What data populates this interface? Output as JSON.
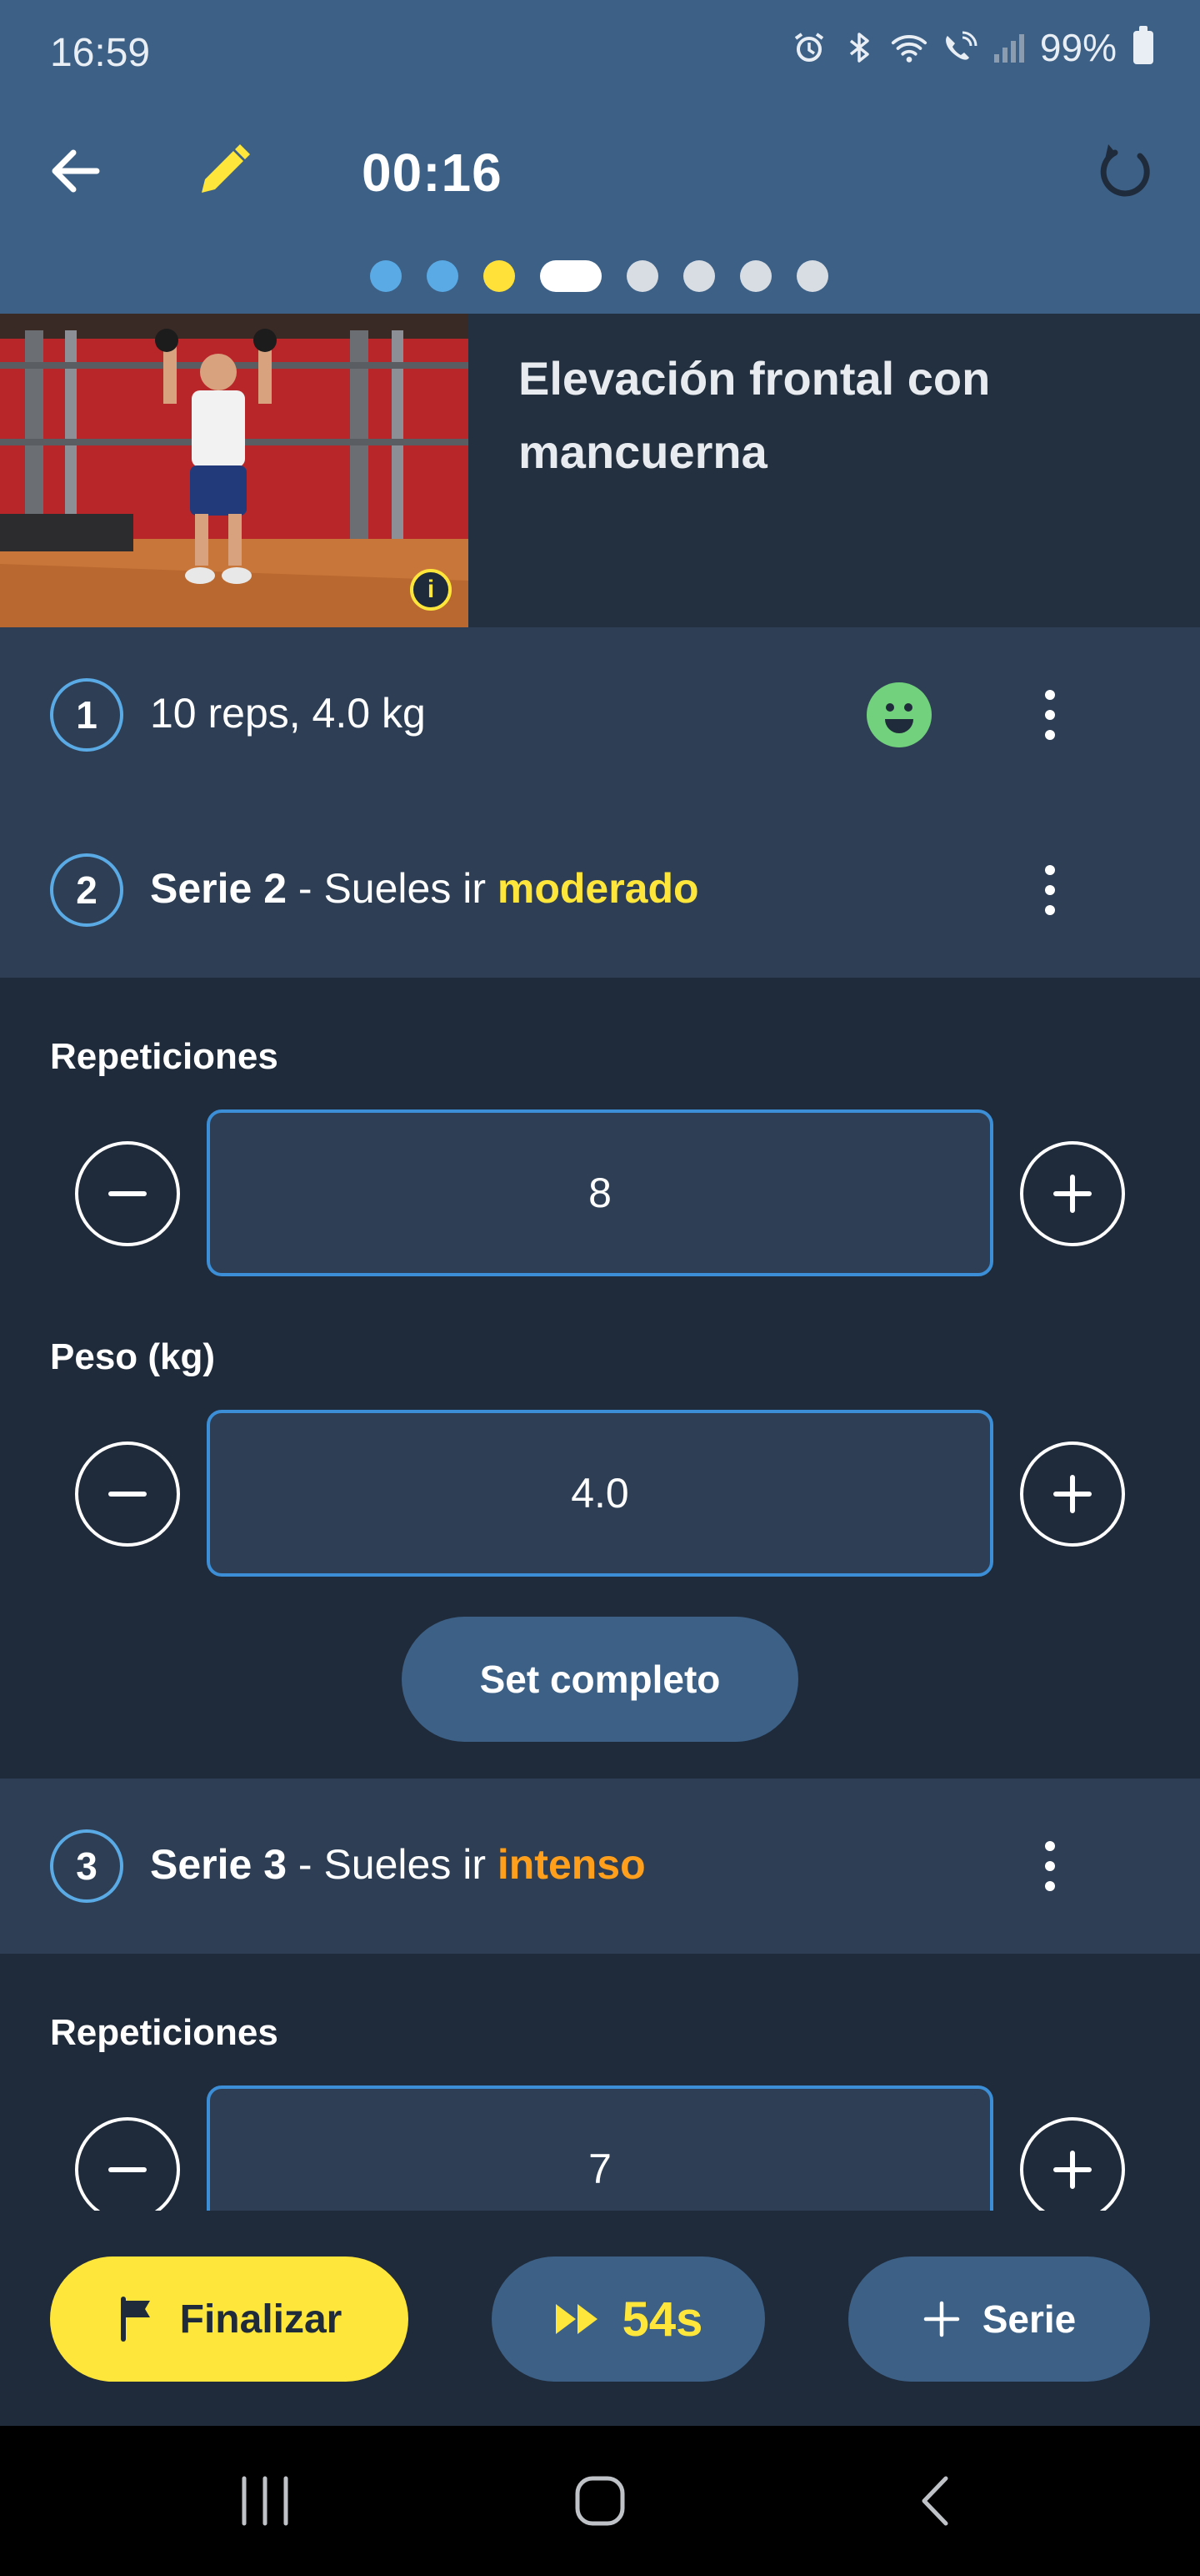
{
  "status_bar": {
    "time": "16:59",
    "battery": "99%",
    "icons": [
      "alarm-icon",
      "bluetooth-icon",
      "wifi-icon",
      "wifi-calling-icon",
      "signal-icon",
      "battery-icon"
    ]
  },
  "toolbar": {
    "timer": "00:16",
    "back_icon": "arrow-left-icon",
    "edit_icon": "pencil-icon",
    "restart_icon": "restart-icon",
    "progress": {
      "total": 8,
      "current_index": 3,
      "done": 2
    }
  },
  "exercise": {
    "title": "Elevación frontal con mancuerna",
    "info_icon": "info-icon"
  },
  "sets": [
    {
      "number": "1",
      "summary": "10 reps, 4.0 kg",
      "status_icon": "smiley-icon"
    },
    {
      "number": "2",
      "title": "Serie 2",
      "prefix": " - Sueles ir ",
      "intensity": "moderado",
      "intensity_color": "#ffe63b"
    },
    {
      "number": "3",
      "title": "Serie 3",
      "prefix": " - Sueles ir ",
      "intensity": "intenso",
      "intensity_color": "#ff9f1c"
    }
  ],
  "editor_set2": {
    "reps_label": "Repeticiones",
    "reps_value": "8",
    "weight_label": "Peso (kg)",
    "weight_value": "4.0",
    "complete_label": "Set completo"
  },
  "editor_set3": {
    "reps_label": "Repeticiones",
    "reps_value": "7"
  },
  "bottom_actions": {
    "finish_label": "Finalizar",
    "rest_label": "54s",
    "add_set_label": "Serie"
  },
  "colors": {
    "header": "#3c6086",
    "background": "#1f2a3a",
    "row": "#2e3f55",
    "accent_yellow": "#ffe63b",
    "accent_orange": "#ff9f1c",
    "accent_blue": "#5aaae6",
    "smiley_green": "#72d17c"
  }
}
